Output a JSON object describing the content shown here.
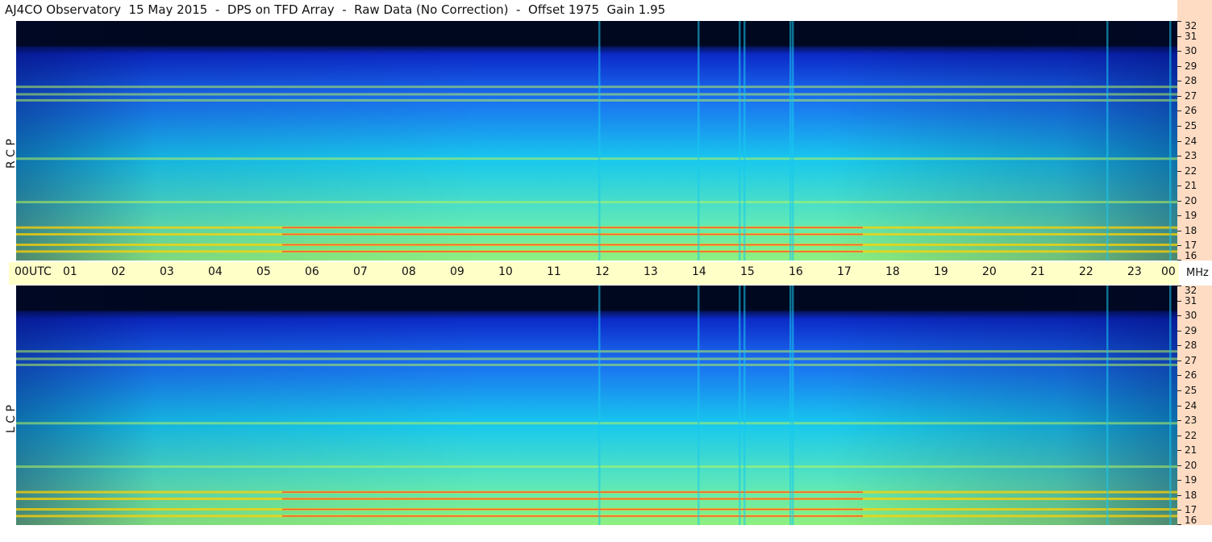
{
  "title": "AJ4CO Observatory  15 May 2015  -  DPS on TFD Array  -  Raw Data (No Correction)  -  Offset 1975  Gain 1.95",
  "polarizations": {
    "top": "R C P",
    "bottom": "L C P"
  },
  "time_axis": {
    "labels": [
      "00",
      "01",
      "02",
      "03",
      "04",
      "05",
      "06",
      "07",
      "08",
      "09",
      "10",
      "11",
      "12",
      "13",
      "14",
      "15",
      "16",
      "17",
      "18",
      "19",
      "20",
      "21",
      "22",
      "23",
      "00"
    ],
    "utc_label": "UTC",
    "unit_right": "MHz"
  },
  "chart_data": {
    "type": "heatmap",
    "title": "AJ4CO Observatory  15 May 2015  -  DPS on TFD Array  -  Raw Data (No Correction)  -  Offset 1975  Gain 1.95",
    "panels": [
      "R C P",
      "L C P"
    ],
    "x_range_hours_utc": [
      0,
      24
    ],
    "y_unit": "MHz",
    "y_range_mhz": [
      16,
      32
    ],
    "y_ticks": [
      16,
      17,
      18,
      19,
      20,
      21,
      22,
      23,
      24,
      25,
      26,
      27,
      28,
      29,
      30,
      31,
      32
    ],
    "colormap": [
      "#000820",
      "#0c2ac8",
      "#1a6ef0",
      "#18c8ee",
      "#b8f55a",
      "#ffd200",
      "#ff2a46"
    ],
    "features": {
      "sustained_interference_bands_mhz": [
        16.6,
        17.05,
        17.75,
        18.2,
        19.9,
        22.8,
        26.7,
        27.1,
        27.6
      ],
      "vertical_bursts_utc_hours": [
        12.05,
        14.1,
        14.95,
        15.05,
        16.0,
        16.05,
        22.55,
        23.85
      ],
      "high_freq_dropout_above_mhz": 30.3
    }
  },
  "colors": {
    "time_strip": "#ffffc8",
    "mhz_strip": "#fedcc3"
  }
}
